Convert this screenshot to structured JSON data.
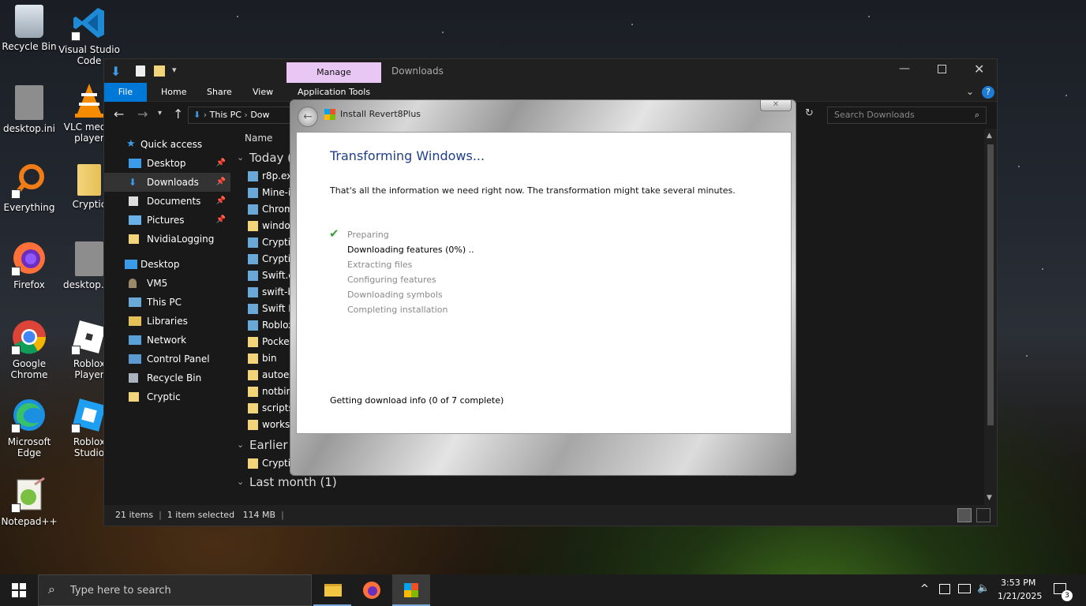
{
  "desktop": {
    "icons": [
      {
        "name": "recycle-bin",
        "label": "Recycle Bin"
      },
      {
        "name": "visual-studio-code",
        "label": "Visual Studio Code"
      },
      {
        "name": "desktop-ini-1",
        "label": "desktop.ini"
      },
      {
        "name": "vlc",
        "label": "VLC media player"
      },
      {
        "name": "everything",
        "label": "Everything"
      },
      {
        "name": "cryptic-folder",
        "label": "Cryptic"
      },
      {
        "name": "firefox",
        "label": "Firefox"
      },
      {
        "name": "desktop-ini-2",
        "label": "desktop.ini"
      },
      {
        "name": "google-chrome",
        "label": "Google Chrome"
      },
      {
        "name": "roblox-player",
        "label": "Roblox Player"
      },
      {
        "name": "microsoft-edge",
        "label": "Microsoft Edge"
      },
      {
        "name": "roblox-studio",
        "label": "Roblox Studio"
      },
      {
        "name": "notepad-plus-plus",
        "label": "Notepad++"
      }
    ]
  },
  "explorer": {
    "context_tab": "Manage",
    "title": "Downloads",
    "tabs": [
      "File",
      "Home",
      "Share",
      "View",
      "Application Tools"
    ],
    "breadcrumb": [
      "This PC",
      "Dow"
    ],
    "search_placeholder": "Search Downloads",
    "column_name": "Name",
    "quick_access": "Quick access",
    "nav": [
      {
        "label": "Desktop",
        "pinned": true
      },
      {
        "label": "Downloads",
        "pinned": true,
        "selected": true
      },
      {
        "label": "Documents",
        "pinned": true
      },
      {
        "label": "Pictures",
        "pinned": true
      },
      {
        "label": "NvidiaLogging",
        "pinned": false
      }
    ],
    "nav2": [
      "Desktop",
      "VM5",
      "This PC",
      "Libraries",
      "Network",
      "Control Panel",
      "Recycle Bin",
      "Cryptic"
    ],
    "group_today": "Today (",
    "files_today": [
      "r8p.exe",
      "Mine-i",
      "Chrom",
      "windo",
      "Cryptic",
      "Cryptic",
      "Swift.e",
      "swift-b",
      "Swift E",
      "Roblox",
      "Pocke",
      "bin",
      "autoex",
      "notbin",
      "scripts",
      "worksp"
    ],
    "group_earlier": "Earlier t",
    "files_earlier": [
      "Cryptic"
    ],
    "group_last_month": "Last month (1)",
    "status": {
      "items": "21 items",
      "selected": "1 item selected",
      "size": "114 MB"
    }
  },
  "installer": {
    "title": "Install Revert8Plus",
    "heading": "Transforming Windows...",
    "subtitle": "That's all the information we need right now. The transformation might take several minutes.",
    "steps": [
      {
        "label": "Preparing",
        "state": "done"
      },
      {
        "label": "Downloading features (0%) ..",
        "state": "active"
      },
      {
        "label": "Extracting files",
        "state": "pending"
      },
      {
        "label": "Configuring features",
        "state": "pending"
      },
      {
        "label": "Downloading symbols",
        "state": "pending"
      },
      {
        "label": "Completing installation",
        "state": "pending"
      }
    ],
    "status": "Getting download info (0 of 7 complete)"
  },
  "taskbar": {
    "search_placeholder": "Type here to search",
    "time": "3:53 PM",
    "date": "1/21/2025",
    "notifications": "3"
  },
  "colors": {
    "accent": "#0078d7",
    "manage_tab": "#e8c7f5",
    "heading_blue": "#1f3f8a",
    "check_green": "#3aa13a"
  }
}
